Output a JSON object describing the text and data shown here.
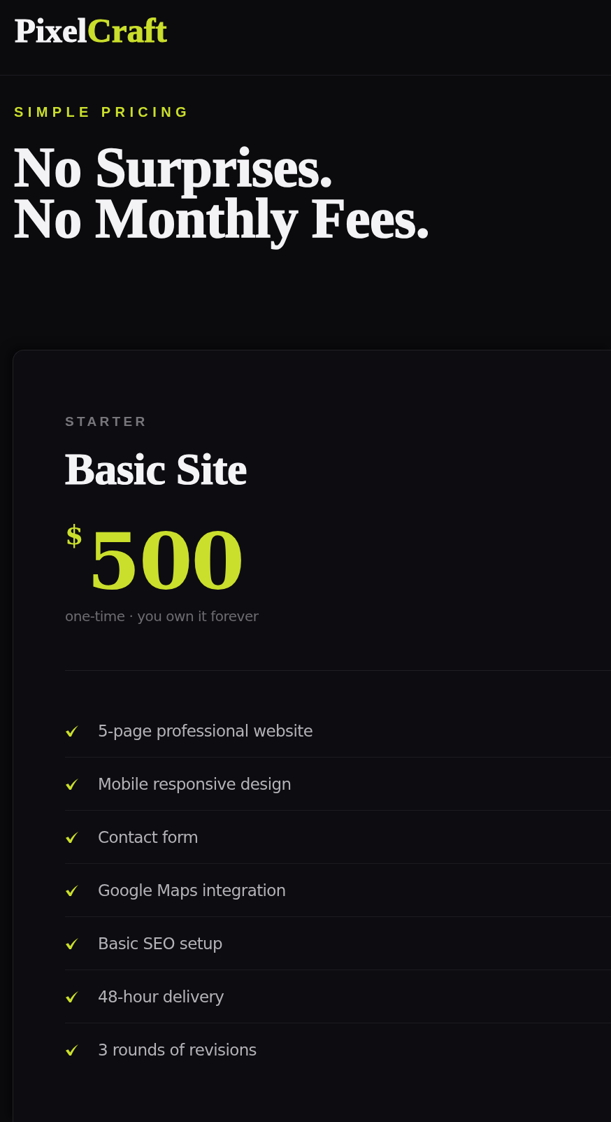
{
  "header": {
    "logo": {
      "primary": "Pixel",
      "accent": "Craft"
    }
  },
  "intro": {
    "eyebrow": "SIMPLE PRICING",
    "headline": [
      "No Surprises.",
      "No Monthly Fees."
    ]
  },
  "plan": {
    "tier": "STARTER",
    "name": "Basic Site",
    "price": {
      "currency": "$",
      "amount": "500"
    },
    "note": "one-time · you own it forever",
    "features": [
      "5-page professional website",
      "Mobile responsive design",
      "Contact form",
      "Google Maps integration",
      "Basic SEO setup",
      "48-hour delivery",
      "3 rounds of revisions"
    ]
  }
}
